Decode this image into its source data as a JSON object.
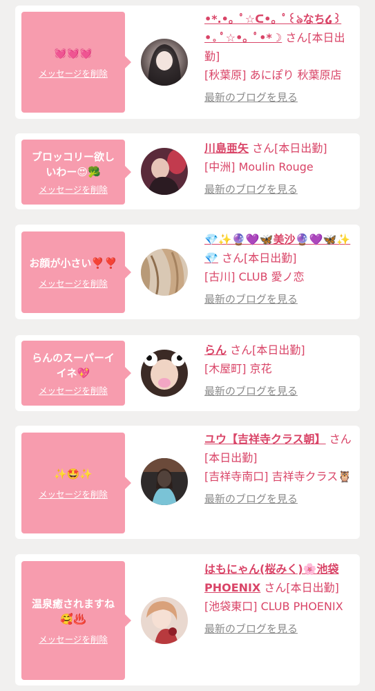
{
  "san_label": "さん[本日出勤]",
  "delete_label": "メッセージを削除",
  "blog_label": "最新のブログを見る",
  "cards": [
    {
      "message": "💓💓💓",
      "name": "•*.•。ﾟ☆ᑕ•。ﾟ꒰ঌなち໒꒱•。ﾟ☆•。ﾟ•*☽",
      "location": "[秋葉原] あにぽり 秋葉原店"
    },
    {
      "message": "ブロッコリー欲しいわー😍🥦",
      "name": "川島亜矢",
      "location": "[中洲] Moulin Rouge"
    },
    {
      "message": "お顔が小さい❣️❣️",
      "name": "💎✨🔮💜🦋美沙🔮💜🦋✨💎",
      "location": "[古川] CLUB 愛ノ恋"
    },
    {
      "message": "らんのスーパーイイネ💖",
      "name": "らん",
      "location": "[木屋町] 京花"
    },
    {
      "message": "✨🤩✨",
      "name": "ユウ【吉祥寺クラス朝】",
      "location": "[吉祥寺南口] 吉祥寺クラス🦉"
    },
    {
      "message": "温泉癒されますね🥰♨️",
      "name": "はもにゃん(桜みく)🌸池袋PHOENIX",
      "location": "[池袋東口] CLUB PHOENIX"
    }
  ]
}
